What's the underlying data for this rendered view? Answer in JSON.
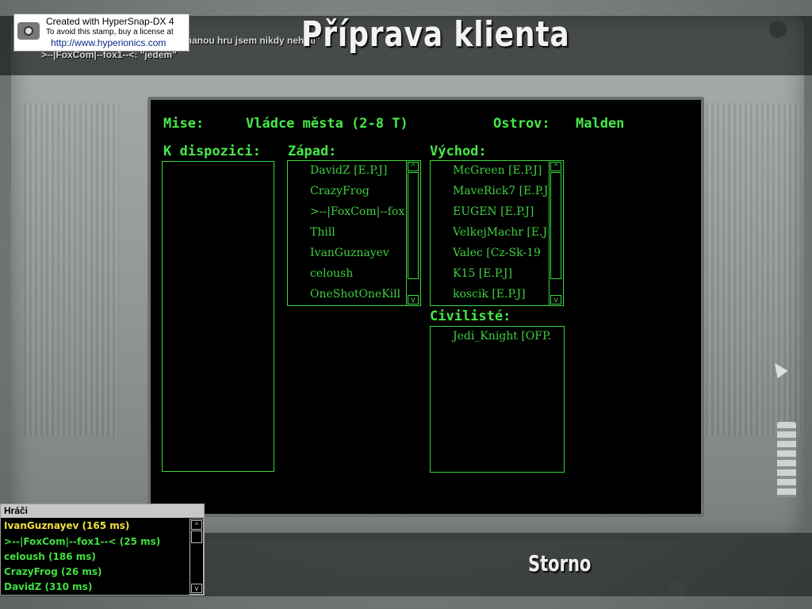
{
  "title": "Příprava klienta",
  "stamp": {
    "line1": "Created with HyperSnap-DX 4",
    "line2": "To avoid this stamp, buy a license at",
    "line3": "http://www.hyperionics.com"
  },
  "chat": {
    "line1": "chanou hru jsem nikdy nehral\"",
    "line2": ">--|FoxCom|--fox1--<: \"jedem\""
  },
  "mission": {
    "label": "Mise:",
    "value": "Vládce města (2-8 T)"
  },
  "island": {
    "label": "Ostrov:",
    "value": "Malden"
  },
  "available": {
    "label": "K dispozici:",
    "items": []
  },
  "west": {
    "label": "Západ:",
    "items": [
      "DavidZ [E.P.J]",
      "CrazyFrog",
      ">--|FoxCom|--fox",
      "Thill",
      "IvanGuznayev",
      "celoush",
      "OneShotOneKill"
    ]
  },
  "east": {
    "label": "Východ:",
    "items": [
      "McGreen [E.P.J]",
      "MaveRick7 [E.P.J",
      "EUGEN [E.P.J]",
      "VelkejMachr [E.J",
      "Valec [Cz-Sk-19",
      "K15 [E.P.J]",
      "koscik [E.P.J]"
    ]
  },
  "civilians": {
    "label": "Civilisté:",
    "items": [
      "Jedi_Knight [OFP."
    ]
  },
  "players": {
    "header": "Hráči",
    "items": [
      {
        "text": "IvanGuznayev  (165 ms)",
        "color": "#f0e040"
      },
      {
        "text": ">--|FoxCom|--fox1--<  (25 ms)",
        "color": "#3fe03f"
      },
      {
        "text": "celoush  (186 ms)",
        "color": "#3fe03f"
      },
      {
        "text": "CrazyFrog  (26 ms)",
        "color": "#3fe03f"
      },
      {
        "text": "DavidZ  (310 ms)",
        "color": "#3fe03f"
      }
    ]
  },
  "storno_label": "Storno",
  "colors": {
    "green": "#48e848",
    "highlight": "#f0e040",
    "screen": "#000000"
  }
}
